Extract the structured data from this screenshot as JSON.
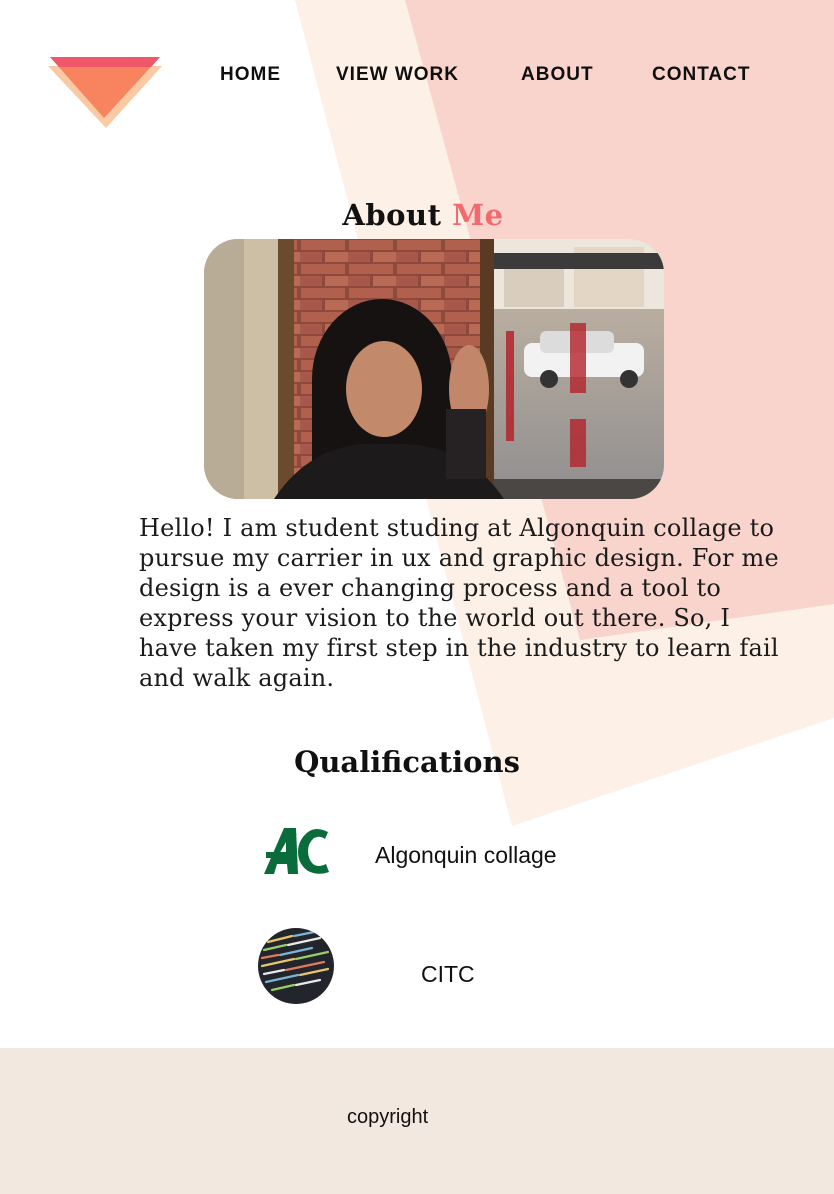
{
  "nav": {
    "items": [
      {
        "label": "HOME"
      },
      {
        "label": "VIEW WORK"
      },
      {
        "label": "ABOUT"
      },
      {
        "label": "CONTACT"
      }
    ]
  },
  "about": {
    "title_main": "About",
    "title_accent": "Me",
    "bio": "Hello!  I am student studing at Algonquin collage to pursue my carrier in ux and graphic design.  For me design is a ever changing process and a tool to express your vision to the world out there. So, I have taken my first step in the industry to learn fail and walk again."
  },
  "qualifications": {
    "title": "Qualifications",
    "items": [
      {
        "name": "Algonquin collage",
        "icon": "algonquin-logo-icon"
      },
      {
        "name": "CITC",
        "icon": "code-screen-icon"
      }
    ]
  },
  "footer": {
    "copyright": "copyright"
  },
  "colors": {
    "accent": "#f06a6e",
    "peach_bg": "#fdf0e6",
    "pink_bg": "#f9d4cc",
    "footer_bg": "#f3e8df",
    "algonquin_green": "#0a6b3b"
  }
}
